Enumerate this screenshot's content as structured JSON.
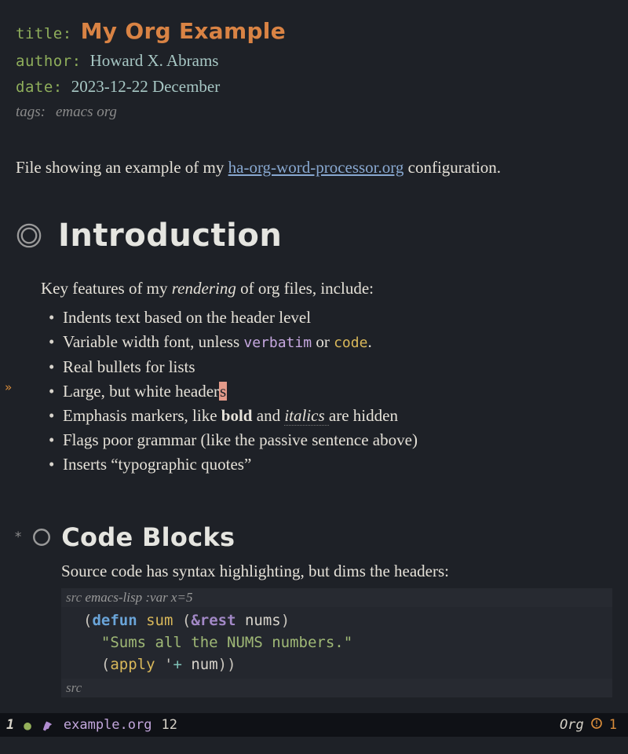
{
  "meta": {
    "title_key": "title:",
    "title_val": "My Org Example",
    "author_key": "author:",
    "author_val": "Howard X. Abrams",
    "date_key": "date:",
    "date_val": "2023-12-22 December",
    "tags_key": "tags:",
    "tags_val": "emacs org"
  },
  "intro": {
    "before_link": "File showing an example of my ",
    "link_text": "ha-org-word-processor.org",
    "after_link": " configuration."
  },
  "h1": {
    "label": "Introduction"
  },
  "body": {
    "p1_before": "Key features of my ",
    "p1_emph": "rendering",
    "p1_after": " of org files, include:",
    "li1": "Indents text based on the header level",
    "li2_a": "Variable width font, unless ",
    "li2_verbatim": "verbatim",
    "li2_b": " or ",
    "li2_code": "code",
    "li2_c": ".",
    "li3": "Real bullets for lists",
    "li4_a": "Large, but white header",
    "li4_cursor": "s",
    "li5_a": "Emphasis markers, like ",
    "li5_bold": "bold",
    "li5_b": " and ",
    "li5_ital": "italics ",
    "li5_c": "are hidden",
    "li6": "Flags poor grammar (like the passive sentence above)",
    "li7": "Inserts “typographic quotes”"
  },
  "h2": {
    "star": "*",
    "label": "Code Blocks"
  },
  "body2": {
    "p1": "Source code has syntax highlighting, but dims the headers:",
    "src_header_kw": "src",
    "src_header_rest": " emacs-lisp :var x=5",
    "code": {
      "l1_a": "(",
      "l1_kw": "defun",
      "l1_b": " ",
      "l1_fn": "sum",
      "l1_c": " (",
      "l1_amp": "&rest",
      "l1_d": " ",
      "l1_var": "nums",
      "l1_e": ")",
      "l2": "\"Sums all the NUMS numbers.\"",
      "l3_a": "(",
      "l3_fn": "apply",
      "l3_b": " '",
      "l3_sym": "+",
      "l3_c": " ",
      "l3_var": "num",
      "l3_d": "))"
    },
    "src_footer": "src"
  },
  "modeline": {
    "window": "1",
    "filename": "example.org",
    "line": "12",
    "mode": "Org",
    "warn_count": "1"
  }
}
